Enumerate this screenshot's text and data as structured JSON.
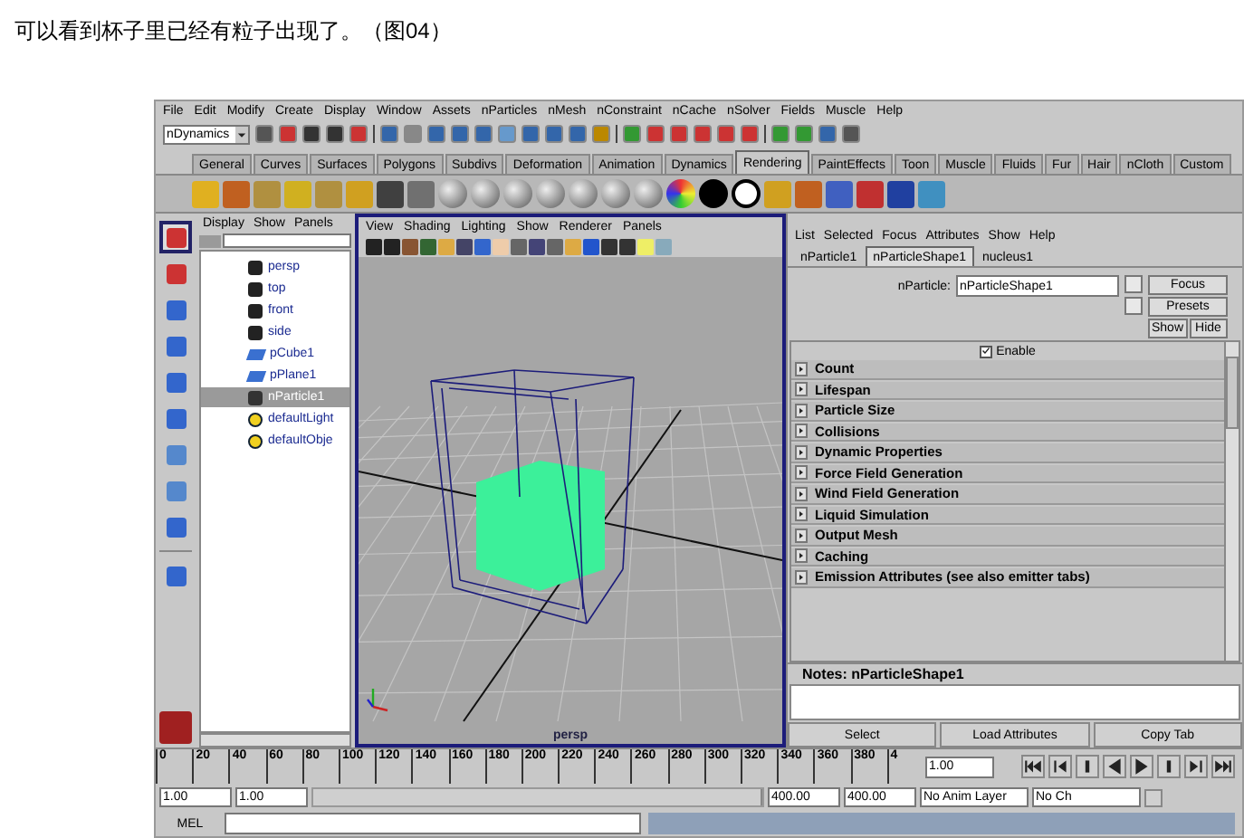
{
  "caption": "可以看到杯子里已经有粒子出现了。（图04）",
  "menu_bar": [
    "File",
    "Edit",
    "Modify",
    "Create",
    "Display",
    "Window",
    "Assets",
    "nParticles",
    "nMesh",
    "nConstraint",
    "nCache",
    "nSolver",
    "Fields",
    "Muscle",
    "Help"
  ],
  "status_line": {
    "mode": "nDynamics"
  },
  "shelf_tabs": [
    {
      "label": "General",
      "selected": false
    },
    {
      "label": "Curves",
      "selected": false
    },
    {
      "label": "Surfaces",
      "selected": false
    },
    {
      "label": "Polygons",
      "selected": false
    },
    {
      "label": "Subdivs",
      "selected": false
    },
    {
      "label": "Deformation",
      "selected": false
    },
    {
      "label": "Animation",
      "selected": false
    },
    {
      "label": "Dynamics",
      "selected": false
    },
    {
      "label": "Rendering",
      "selected": true
    },
    {
      "label": "PaintEffects",
      "selected": false
    },
    {
      "label": "Toon",
      "selected": false
    },
    {
      "label": "Muscle",
      "selected": false
    },
    {
      "label": "Fluids",
      "selected": false
    },
    {
      "label": "Fur",
      "selected": false
    },
    {
      "label": "Hair",
      "selected": false
    },
    {
      "label": "nCloth",
      "selected": false
    },
    {
      "label": "Custom",
      "selected": false
    }
  ],
  "outliner": {
    "menu": [
      "Display",
      "Show",
      "Panels"
    ],
    "items": [
      {
        "label": "persp",
        "kind": "camera",
        "selected": false
      },
      {
        "label": "top",
        "kind": "camera",
        "selected": false
      },
      {
        "label": "front",
        "kind": "camera",
        "selected": false
      },
      {
        "label": "side",
        "kind": "camera",
        "selected": false
      },
      {
        "label": "pCube1",
        "kind": "mesh",
        "selected": false
      },
      {
        "label": "pPlane1",
        "kind": "mesh",
        "selected": false
      },
      {
        "label": "nParticle1",
        "kind": "particle",
        "selected": true
      },
      {
        "label": "defaultLight",
        "kind": "set",
        "selected": false
      },
      {
        "label": "defaultObje",
        "kind": "set",
        "selected": false
      }
    ]
  },
  "viewport": {
    "menu": [
      "View",
      "Shading",
      "Lighting",
      "Show",
      "Renderer",
      "Panels"
    ],
    "camera_label": "persp"
  },
  "attribute_editor": {
    "menu": [
      "List",
      "Selected",
      "Focus",
      "Attributes",
      "Show",
      "Help"
    ],
    "tabs": [
      {
        "label": "nParticle1",
        "selected": false
      },
      {
        "label": "nParticleShape1",
        "selected": true
      },
      {
        "label": "nucleus1",
        "selected": false
      }
    ],
    "node_label": "nParticle:",
    "node_value": "nParticleShape1",
    "side_buttons": [
      "Focus",
      "Presets",
      "Show",
      "Hide"
    ],
    "enable": {
      "label": "Enable",
      "checked": true
    },
    "sections": [
      "Count",
      "Lifespan",
      "Particle Size",
      "Collisions",
      "Dynamic Properties",
      "Force Field Generation",
      "Wind Field Generation",
      "Liquid Simulation",
      "Output Mesh",
      "Caching",
      "Emission Attributes (see also emitter tabs)"
    ],
    "notes_label": "Notes:  nParticleShape1",
    "footer_buttons": [
      "Select",
      "Load Attributes",
      "Copy Tab"
    ]
  },
  "timeline": {
    "ticks": [
      "0",
      "20",
      "40",
      "60",
      "80",
      "100",
      "120",
      "140",
      "160",
      "180",
      "200",
      "220",
      "240",
      "260",
      "280",
      "300",
      "320",
      "340",
      "360",
      "380",
      "4"
    ],
    "current_frame": "1.00"
  },
  "range": {
    "level": 1,
    "start": "1.00",
    "playback_start": "1.00",
    "playback_end": "400.00",
    "end": "400.00",
    "anim_layer": "No Anim Layer",
    "character_set": "No Ch"
  },
  "command_line": {
    "label": "MEL"
  }
}
